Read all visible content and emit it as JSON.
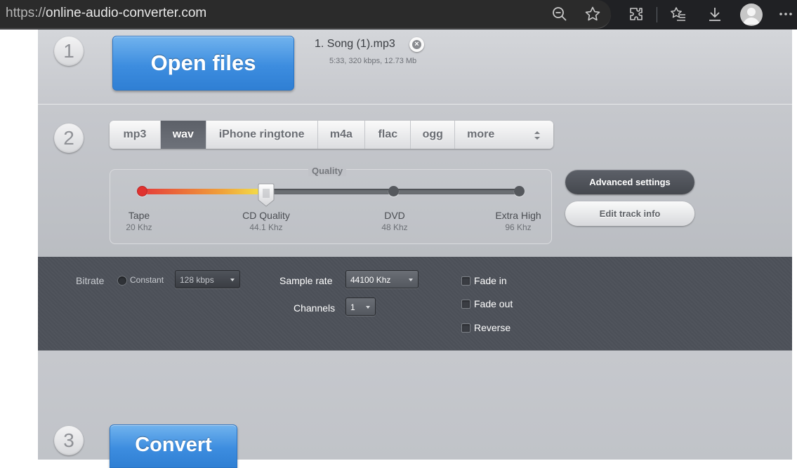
{
  "browser": {
    "url_proto": "https://",
    "url_host": "online-audio-converter.com"
  },
  "step1": {
    "number": "1",
    "open_button": "Open files",
    "file": {
      "index": "1.",
      "name": "Song (1).mp3",
      "meta": "5:33, 320 kbps, 12.73 Mb"
    }
  },
  "step2": {
    "number": "2",
    "formats": [
      "mp3",
      "wav",
      "iPhone ringtone",
      "m4a",
      "flac",
      "ogg",
      "more"
    ],
    "selected_format": "wav",
    "quality": {
      "title": "Quality",
      "levels": [
        {
          "label": "Tape",
          "sub": "20 Khz"
        },
        {
          "label": "CD Quality",
          "sub": "44.1 Khz"
        },
        {
          "label": "DVD",
          "sub": "48 Khz"
        },
        {
          "label": "Extra High",
          "sub": "96 Khz"
        }
      ],
      "selected_level": "CD Quality"
    },
    "advanced_button": "Advanced settings",
    "track_info_button": "Edit track info"
  },
  "advanced": {
    "bitrate_label": "Bitrate",
    "constant_label": "Constant",
    "bitrate_value": "128 kbps",
    "sample_rate_label": "Sample rate",
    "sample_rate_value": "44100 Khz",
    "channels_label": "Channels",
    "channels_value": "1",
    "fade_in": "Fade in",
    "fade_out": "Fade out",
    "reverse": "Reverse"
  },
  "step3": {
    "number": "3",
    "convert_button": "Convert"
  },
  "colors": {
    "accent_blue": "#3d8ddf",
    "tab_active": "#5c6068",
    "panel_dark": "#4c5058"
  }
}
